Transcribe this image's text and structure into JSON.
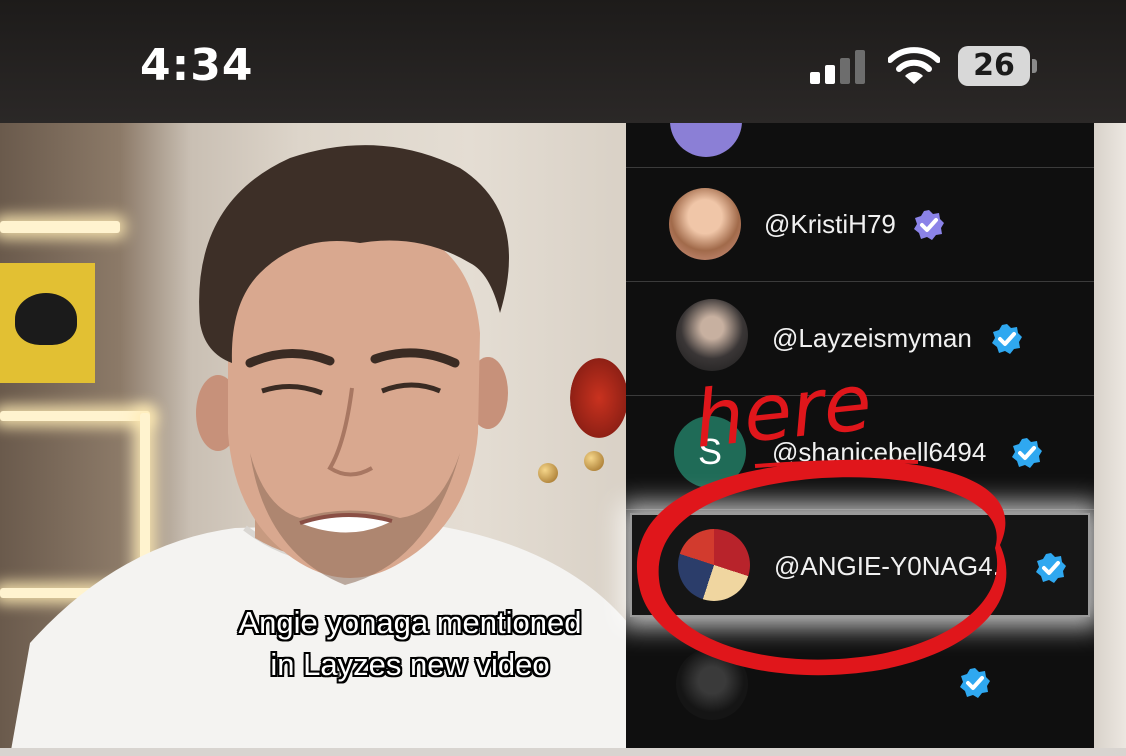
{
  "status_bar": {
    "time": "4:34",
    "battery": "26",
    "signal_icon": "cellular-signal-icon",
    "wifi_icon": "wifi-icon",
    "battery_icon": "battery-icon"
  },
  "mentions": [
    {
      "handle": "@KristiH79",
      "verified": true,
      "badge_color": "#8b83e8"
    },
    {
      "handle": "@Layzeismyman",
      "verified": true,
      "badge_color": "#2fa8f0"
    },
    {
      "handle": "@shanicebell6494",
      "verified": true,
      "badge_color": "#2fa8f0",
      "avatar_letter": "S"
    },
    {
      "handle": "@ANGIE-Y0NAG4..",
      "verified": true,
      "badge_color": "#2fa8f0"
    },
    {
      "handle": "",
      "verified": true,
      "badge_color": "#2fa8f0"
    }
  ],
  "annotation": {
    "text": "here",
    "color": "#e0161b"
  },
  "caption": {
    "line1": "Angie yonaga mentioned",
    "line2": "in Layzes new video"
  }
}
